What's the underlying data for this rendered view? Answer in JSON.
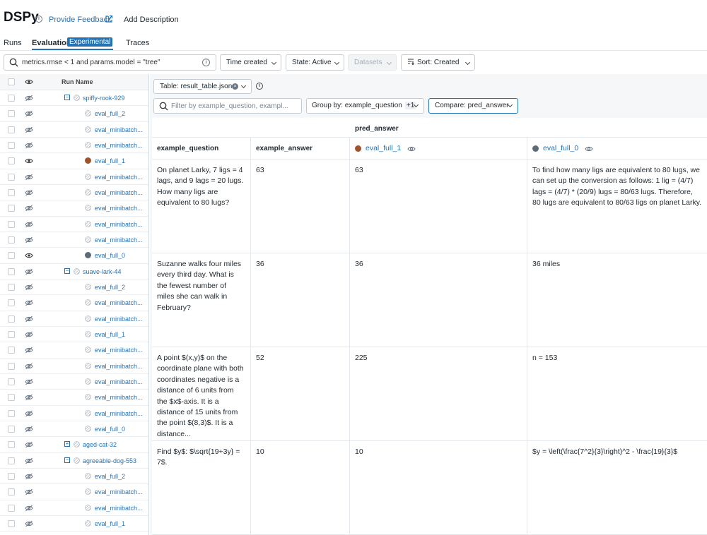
{
  "app": {
    "title": "DSPy",
    "feedback_label": "Provide Feedback",
    "add_description_label": "Add Description"
  },
  "tabs": [
    {
      "label": "Runs"
    },
    {
      "label": "Evaluation",
      "badge": "Experimental",
      "active": true
    },
    {
      "label": "Traces"
    }
  ],
  "filters": {
    "search_value": "metrics.rmse < 1 and params.model = \"tree\"",
    "time_created": "Time created",
    "state": "State: Active",
    "datasets": "Datasets",
    "sort": "Sort: Created"
  },
  "runs_table": {
    "column_header": "Run Name",
    "rows": [
      {
        "label": "spiffy-rook-929",
        "type": "parent",
        "expander": "−",
        "visible": false
      },
      {
        "label": "eval_full_2",
        "type": "child",
        "visible": false
      },
      {
        "label": "eval_minibatch...",
        "type": "child",
        "visible": false
      },
      {
        "label": "eval_minibatch...",
        "type": "child",
        "visible": false
      },
      {
        "label": "eval_full_1",
        "type": "child",
        "visible": true,
        "color": "#a0522d"
      },
      {
        "label": "eval_minibatch...",
        "type": "child",
        "visible": false
      },
      {
        "label": "eval_minibatch...",
        "type": "child",
        "visible": false
      },
      {
        "label": "eval_minibatch...",
        "type": "child",
        "visible": false
      },
      {
        "label": "eval_minibatch...",
        "type": "child",
        "visible": false
      },
      {
        "label": "eval_minibatch...",
        "type": "child",
        "visible": false
      },
      {
        "label": "eval_full_0",
        "type": "child",
        "visible": true,
        "color": "#5f6b76"
      },
      {
        "label": "suave-lark-44",
        "type": "parent",
        "expander": "−",
        "visible": false
      },
      {
        "label": "eval_full_2",
        "type": "child",
        "visible": false
      },
      {
        "label": "eval_minibatch...",
        "type": "child",
        "visible": false
      },
      {
        "label": "eval_minibatch...",
        "type": "child",
        "visible": false
      },
      {
        "label": "eval_full_1",
        "type": "child",
        "visible": false
      },
      {
        "label": "eval_minibatch...",
        "type": "child",
        "visible": false
      },
      {
        "label": "eval_minibatch...",
        "type": "child",
        "visible": false
      },
      {
        "label": "eval_minibatch...",
        "type": "child",
        "visible": false
      },
      {
        "label": "eval_minibatch...",
        "type": "child",
        "visible": false
      },
      {
        "label": "eval_minibatch...",
        "type": "child",
        "visible": false
      },
      {
        "label": "eval_full_0",
        "type": "child",
        "visible": false
      },
      {
        "label": "aged-cat-32",
        "type": "parent",
        "expander": "+",
        "visible": false
      },
      {
        "label": "agreeable-dog-553",
        "type": "parent",
        "expander": "−",
        "visible": false
      },
      {
        "label": "eval_full_2",
        "type": "child",
        "visible": false
      },
      {
        "label": "eval_minibatch...",
        "type": "child",
        "visible": false
      },
      {
        "label": "eval_minibatch...",
        "type": "child",
        "visible": false
      },
      {
        "label": "eval_full_1",
        "type": "child",
        "visible": false
      }
    ]
  },
  "eval_panel": {
    "table_select": "Table: result_table.json",
    "filter_placeholder": "Filter by example_question, exampl...",
    "group_by": "Group by: example_question",
    "group_by_extra": "+1",
    "compare": "Compare: pred_answer",
    "group_header": "pred_answer",
    "col_question": "example_question",
    "col_answer": "example_answer",
    "run_a": {
      "name": "eval_full_1",
      "color": "#a0522d"
    },
    "run_b": {
      "name": "eval_full_0",
      "color": "#5f6b76"
    },
    "rows": [
      {
        "question": "On planet Larky, 7 ligs = 4 lags, and 9 lags = 20 lugs. How many ligs are equivalent to 80 lugs?",
        "answer": "63",
        "pred_a": "63",
        "pred_b": "To find how many ligs are equivalent to 80 lugs, we can set up the conversion as follows: 1 lig = (4/7) lags = (4/7) * (20/9) lugs = 80/63 lugs. Therefore, 80 lugs are equivalent to 80/63 ligs on planet Larky."
      },
      {
        "question": "Suzanne walks four miles every third day. What is the fewest number of miles she can walk in February?",
        "answer": "36",
        "pred_a": "36",
        "pred_b": "36 miles"
      },
      {
        "question": "A point $(x,y)$ on the coordinate plane with both coordinates negative is a distance of 6 units from the $x$-axis. It is a distance of 15 units from the point $(8,3)$. It is a distance...",
        "answer": "52",
        "pred_a": "225",
        "pred_b": "n = 153"
      },
      {
        "question": "Find $y$: $\\sqrt{19+3y} = 7$.",
        "answer": "10",
        "pred_a": "10",
        "pred_b": "$y = \\left(\\frac{7^2}{3}\\right)^2 - \\frac{19}{3}$"
      }
    ]
  }
}
